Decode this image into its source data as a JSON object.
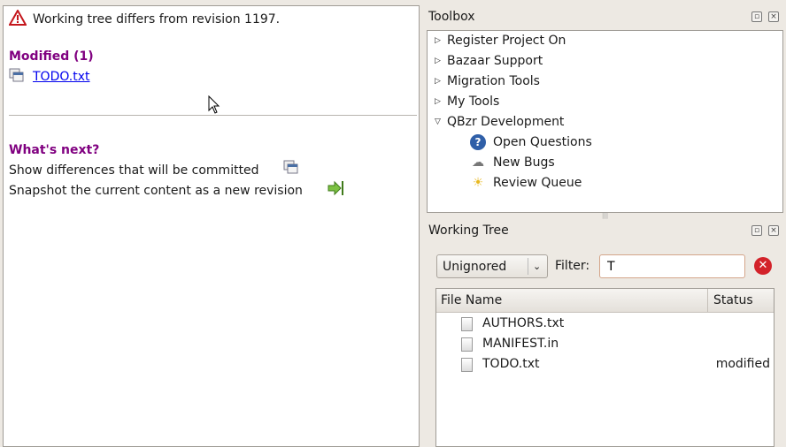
{
  "status": {
    "message": "Working tree differs from revision 1197.",
    "modified_heading": "Modified (1)",
    "modified_files": [
      "TODO.txt"
    ],
    "next_heading": "What's next?",
    "actions": [
      "Show differences that will be committed",
      "Snapshot the current content as a new revision"
    ]
  },
  "toolbox": {
    "title": "Toolbox",
    "groups": [
      "Register Project On",
      "Bazaar Support",
      "Migration Tools",
      "My Tools",
      "QBzr Development"
    ],
    "children": [
      "Open Questions",
      "New Bugs",
      "Review Queue"
    ]
  },
  "working_tree": {
    "title": "Working Tree",
    "view_mode": "Unignored",
    "filter_label": "Filter:",
    "filter_value": "T",
    "columns": [
      "File Name",
      "Status"
    ],
    "rows": [
      {
        "name": "AUTHORS.txt",
        "status": ""
      },
      {
        "name": "MANIFEST.in",
        "status": ""
      },
      {
        "name": "TODO.txt",
        "status": "modified"
      }
    ]
  },
  "colors": {
    "heading": "#800080",
    "link": "#0000ee"
  }
}
